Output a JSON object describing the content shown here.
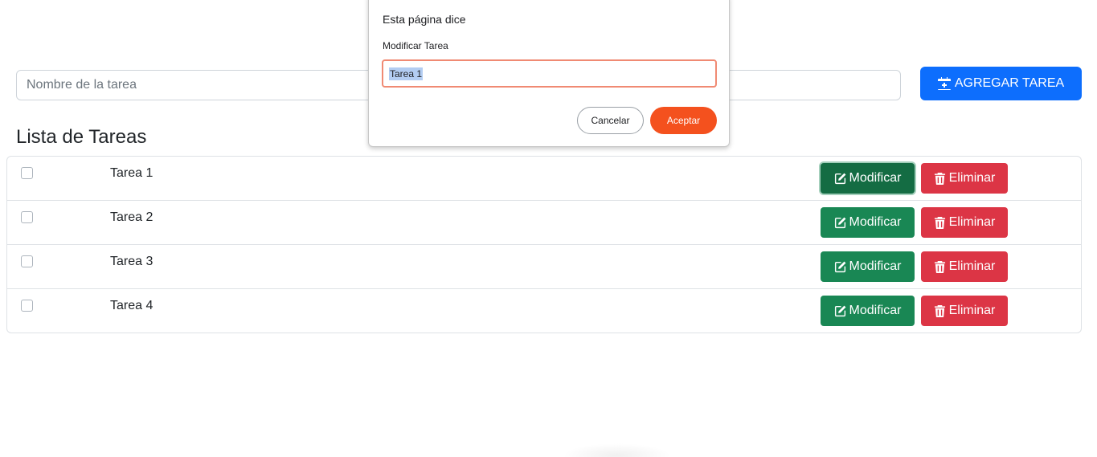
{
  "form": {
    "task_placeholder": "Nombre de la tarea",
    "add_button_label": "AGREGAR TAREA",
    "add_icon": "calendar-plus-icon"
  },
  "list": {
    "title": "Lista de Tareas",
    "edit_label": "Modificar",
    "delete_label": "Eliminar",
    "edit_icon": "edit-icon",
    "delete_icon": "trash-icon",
    "tasks": [
      {
        "name": "Tarea 1",
        "checked": false
      },
      {
        "name": "Tarea 2",
        "checked": false
      },
      {
        "name": "Tarea 3",
        "checked": false
      },
      {
        "name": "Tarea 4",
        "checked": false
      }
    ]
  },
  "dialog": {
    "title": "Esta página dice",
    "message": "Modificar Tarea",
    "input_value": "Tarea 1",
    "cancel_label": "Cancelar",
    "ok_label": "Aceptar"
  },
  "colors": {
    "primary": "#0d6efd",
    "success": "#198754",
    "danger": "#dc3545",
    "dialog_accent": "#f4511e"
  }
}
